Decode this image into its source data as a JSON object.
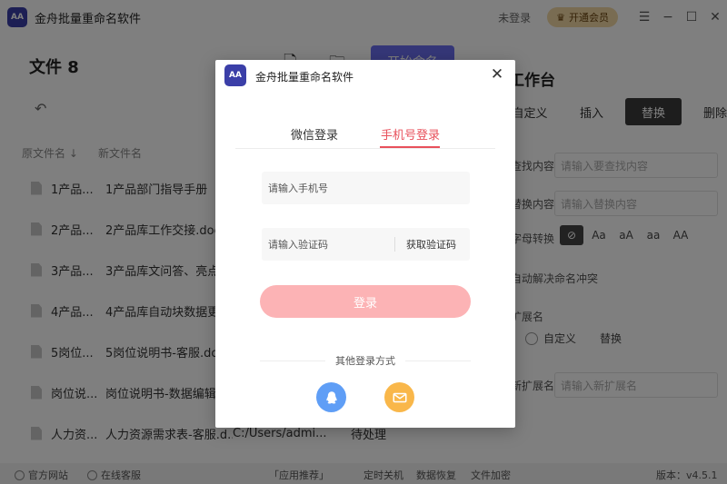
{
  "app": {
    "title": "金舟批量重命名软件",
    "logo_text": "AA",
    "login_status": "未登录",
    "vip_button": "开通会员"
  },
  "main": {
    "file_count_label": "文件 8",
    "start_button": "开始命名",
    "columns": {
      "original": "原文件名 ↓",
      "new": "新文件名"
    },
    "files": [
      {
        "orig": "1产品...",
        "new": "1产品部门指导手册（",
        "path": "",
        "status": ""
      },
      {
        "orig": "2产品...",
        "new": "2产品库工作交接.doc",
        "path": "",
        "status": ""
      },
      {
        "orig": "3产品...",
        "new": "3产品库文问答、亮点",
        "path": "",
        "status": ""
      },
      {
        "orig": "4产品...",
        "new": "4产品库自动块数据更",
        "path": "",
        "status": ""
      },
      {
        "orig": "5岗位...",
        "new": "5岗位说明书-客服.doc",
        "path": "",
        "status": ""
      },
      {
        "orig": "岗位说...",
        "new": "岗位说明书-数据编辑.",
        "path": "",
        "status": ""
      },
      {
        "orig": "人力资...",
        "new": "人力资源需求表-客服.d...",
        "path": "C:/Users/admi...",
        "status": "待处理"
      }
    ]
  },
  "right_panel": {
    "title": "工作台",
    "tabs": [
      "自定义",
      "插入",
      "替换",
      "删除"
    ],
    "active_tab": "替换",
    "find_label": "查找内容",
    "find_placeholder": "请输入要查找内容",
    "replace_label": "替换内容",
    "replace_placeholder": "请输入替换内容",
    "case_label": "字母转换",
    "case_options": [
      "Aa",
      "aA",
      "aa",
      "AA"
    ],
    "auto_resolve": "自动解决命名冲突",
    "ext_label": "扩展名",
    "ext_options": [
      "自定义",
      "替换"
    ],
    "new_ext_label": "新扩展名",
    "new_ext_placeholder": "请输入新扩展名"
  },
  "statusbar": {
    "website": "官方网站",
    "online_service": "在线客服",
    "app_recommend": "「应用推荐」",
    "timed_shutdown": "定时关机",
    "data_recovery": "数据恢复",
    "file_encrypt": "文件加密",
    "version": "版本：v4.5.1"
  },
  "dialog": {
    "title": "金舟批量重命名软件",
    "tabs": [
      "微信登录",
      "手机号登录"
    ],
    "active_tab": "手机号登录",
    "phone_placeholder": "请输入手机号",
    "code_placeholder": "请输入验证码",
    "get_code": "获取验证码",
    "login_button": "登录",
    "other_ways": "其他登录方式",
    "social": [
      "qq-icon",
      "email-icon"
    ],
    "colors": {
      "accent": "#e8505b",
      "login_btn": "#fcb3b5",
      "qq": "#5f9ef6",
      "email": "#f9b74a"
    }
  }
}
